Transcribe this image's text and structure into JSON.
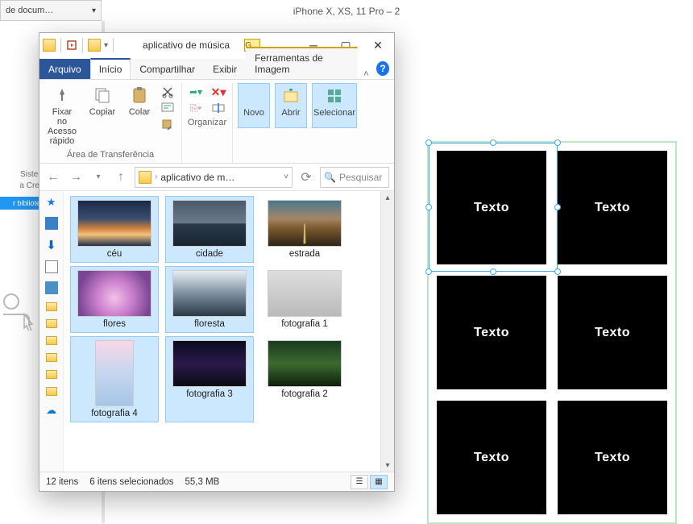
{
  "background": {
    "dropdown_label": "de docum…",
    "artboard_title": "iPhone X, XS, 11 Pro – 2",
    "side_text1": "Sistemas de",
    "side_text2": "a Creative C",
    "side_button": "r bibliotecas"
  },
  "design": {
    "tile_label": "Texto"
  },
  "explorer": {
    "title": "aplicativo de música",
    "pin_label": "G…",
    "menu": {
      "arquivo": "Arquivo",
      "inicio": "Início",
      "compartilhar": "Compartilhar",
      "exibir": "Exibir",
      "ferramentas": "Ferramentas de Imagem"
    },
    "ribbon": {
      "fixar": "Fixar no Acesso rápido",
      "copiar": "Copiar",
      "colar": "Colar",
      "grp_transfer": "Área de Transferência",
      "grp_organizar": "Organizar",
      "novo": "Novo",
      "abrir": "Abrir",
      "selecionar": "Selecionar"
    },
    "address": {
      "crumb": "aplicativo de m…",
      "search_placeholder": "Pesquisar"
    },
    "items": [
      {
        "name": "céu",
        "selected": true,
        "thumb": "th-ceu",
        "orient": "land"
      },
      {
        "name": "cidade",
        "selected": true,
        "thumb": "th-cidade",
        "orient": "land"
      },
      {
        "name": "estrada",
        "selected": false,
        "thumb": "th-estrada",
        "orient": "land"
      },
      {
        "name": "flores",
        "selected": true,
        "thumb": "th-flores",
        "orient": "land"
      },
      {
        "name": "floresta",
        "selected": true,
        "thumb": "th-floresta",
        "orient": "land"
      },
      {
        "name": "fotografia 1",
        "selected": false,
        "thumb": "th-foto1",
        "orient": "land"
      },
      {
        "name": "fotografia 4",
        "selected": true,
        "thumb": "th-foto4",
        "orient": "port"
      },
      {
        "name": "fotografia 3",
        "selected": true,
        "thumb": "th-foto3",
        "orient": "land"
      },
      {
        "name": "fotografia 2",
        "selected": false,
        "thumb": "th-foto2",
        "orient": "land"
      }
    ],
    "status": {
      "count": "12 itens",
      "selected": "6 itens selecionados",
      "size": "55,3 MB"
    }
  }
}
